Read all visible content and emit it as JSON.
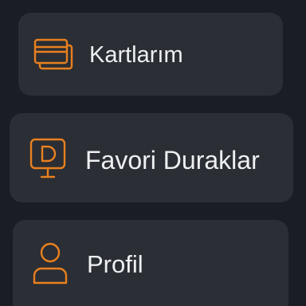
{
  "colors": {
    "background": "#1a1e24",
    "card": "#2b2e34",
    "accent": "#e8801f",
    "text": "#eef0f2"
  },
  "menu": {
    "items": [
      {
        "label": "Kartlarım",
        "icon": "cards-icon"
      },
      {
        "label": "Favori Duraklar",
        "icon": "favorite-stop-sign-icon"
      },
      {
        "label": "Profil",
        "icon": "user-profile-icon"
      }
    ]
  }
}
